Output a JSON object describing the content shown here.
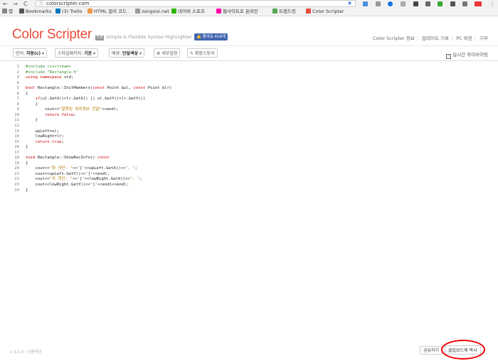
{
  "browser": {
    "url": "colorscripter.com",
    "back": "←",
    "forward": "→",
    "reload": "C",
    "star": "★",
    "bookmarks": [
      {
        "label": "앱",
        "color": "#888"
      },
      {
        "label": "Bookmarks",
        "color": "#555"
      },
      {
        "label": "(3) Trello",
        "color": "#0079bf"
      },
      {
        "label": "HTML 컬러 코드",
        "color": "#e94"
      },
      {
        "label": "zangsisi.net",
        "color": "#999"
      },
      {
        "label": "네이버 스포츠",
        "color": "#2db400"
      },
      {
        "label": "웹사이트로 온라인",
        "color": "#f0a"
      },
      {
        "label": "트렌드킹",
        "color": "#5a5"
      },
      {
        "label": "Color Scripter",
        "color": "#e74c3c"
      }
    ]
  },
  "header": {
    "logo": "Color Scripter",
    "version_badge": "5.8",
    "tagline": "Simple & Flexible Syntax HighLighter",
    "like_label": "좋아요 419개",
    "nav": [
      "Color Scripter 정보",
      "업데이트 기록",
      "PC 버전",
      "기부"
    ]
  },
  "toolbar": {
    "lang_label": "언어:",
    "lang_value": "자동(c)",
    "style_label": "스타일패키지:",
    "style_value": "기본",
    "bg_label": "배경:",
    "bg_value": "단일색상",
    "detail": "세부설정",
    "store": "확장스토어",
    "realtime": "실시간 하이라이팅"
  },
  "code_lines": [
    [
      [
        "pp",
        "#include <iostream>"
      ]
    ],
    [
      [
        "pp",
        "#include \"Rectangle.h\""
      ]
    ],
    [
      [
        "kw",
        "using namespace"
      ],
      [
        "tx",
        " std;"
      ]
    ],
    [],
    [
      [
        "ty",
        "bool"
      ],
      [
        "tx",
        " Rectangle::InitMembers("
      ],
      [
        "kw",
        "const"
      ],
      [
        "tx",
        " Point &ul, "
      ],
      [
        "kw",
        "const"
      ],
      [
        "tx",
        " Point &lr)"
      ]
    ],
    [
      [
        "tx",
        "{"
      ]
    ],
    [
      [
        "tx",
        "    "
      ],
      [
        "kw",
        "if"
      ],
      [
        "tx",
        "(ul.GetX()>lr.GetX() || ul.GetY()>lr.GetY())"
      ]
    ],
    [
      [
        "tx",
        "    {"
      ]
    ],
    [
      [
        "tx",
        "        cout<<"
      ],
      [
        "st",
        "\"잘못된 위치정보 전달\""
      ],
      [
        "tx",
        "<<endl;"
      ]
    ],
    [
      [
        "tx",
        "        "
      ],
      [
        "kw",
        "return false"
      ],
      [
        "tx",
        ";"
      ]
    ],
    [
      [
        "tx",
        "    }"
      ]
    ],
    [],
    [
      [
        "tx",
        "    upLeft=ul;"
      ]
    ],
    [
      [
        "tx",
        "    lowRight=lr;"
      ]
    ],
    [
      [
        "tx",
        "    "
      ],
      [
        "kw",
        "return true"
      ],
      [
        "tx",
        ";"
      ]
    ],
    [
      [
        "tx",
        "}"
      ]
    ],
    [],
    [
      [
        "ty",
        "void"
      ],
      [
        "tx",
        " Rectangle::ShowRecInfo() "
      ],
      [
        "kw",
        "const"
      ]
    ],
    [
      [
        "tx",
        "{"
      ]
    ],
    [
      [
        "tx",
        "    cout<<"
      ],
      [
        "st",
        "\"좌 상단: \""
      ],
      [
        "tx",
        "<<'['<<upLeft.GetX()<<"
      ],
      [
        "st",
        "\", \""
      ],
      [
        "tx",
        ";"
      ]
    ],
    [
      [
        "tx",
        "    cout<<upLeft.GetY()<<']'<<endl;"
      ]
    ],
    [
      [
        "tx",
        "    cout<<"
      ],
      [
        "st",
        "\"우 하단: \""
      ],
      [
        "tx",
        "<<'['<<lowRight.GetX()<<"
      ],
      [
        "st",
        "\", \""
      ],
      [
        "tx",
        ";"
      ]
    ],
    [
      [
        "tx",
        "    cout<<lowRight.GetY()<<']'<<endl<<endl;"
      ]
    ],
    [
      [
        "tx",
        "}"
      ]
    ]
  ],
  "footer": {
    "version": "v 3.3.0  ·  이용약관",
    "share": "공유하기",
    "copy": "클립보드에 복사"
  }
}
